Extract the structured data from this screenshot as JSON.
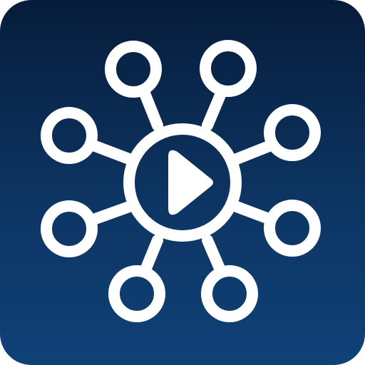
{
  "app_icon": {
    "icon_name": "video-network-hub-icon",
    "background_gradient": [
      "#061c3b",
      "#0d3563",
      "#0f4177"
    ],
    "symbol_color": "#ffffff",
    "center_symbol": "play-icon",
    "outer_node_count": 8
  }
}
